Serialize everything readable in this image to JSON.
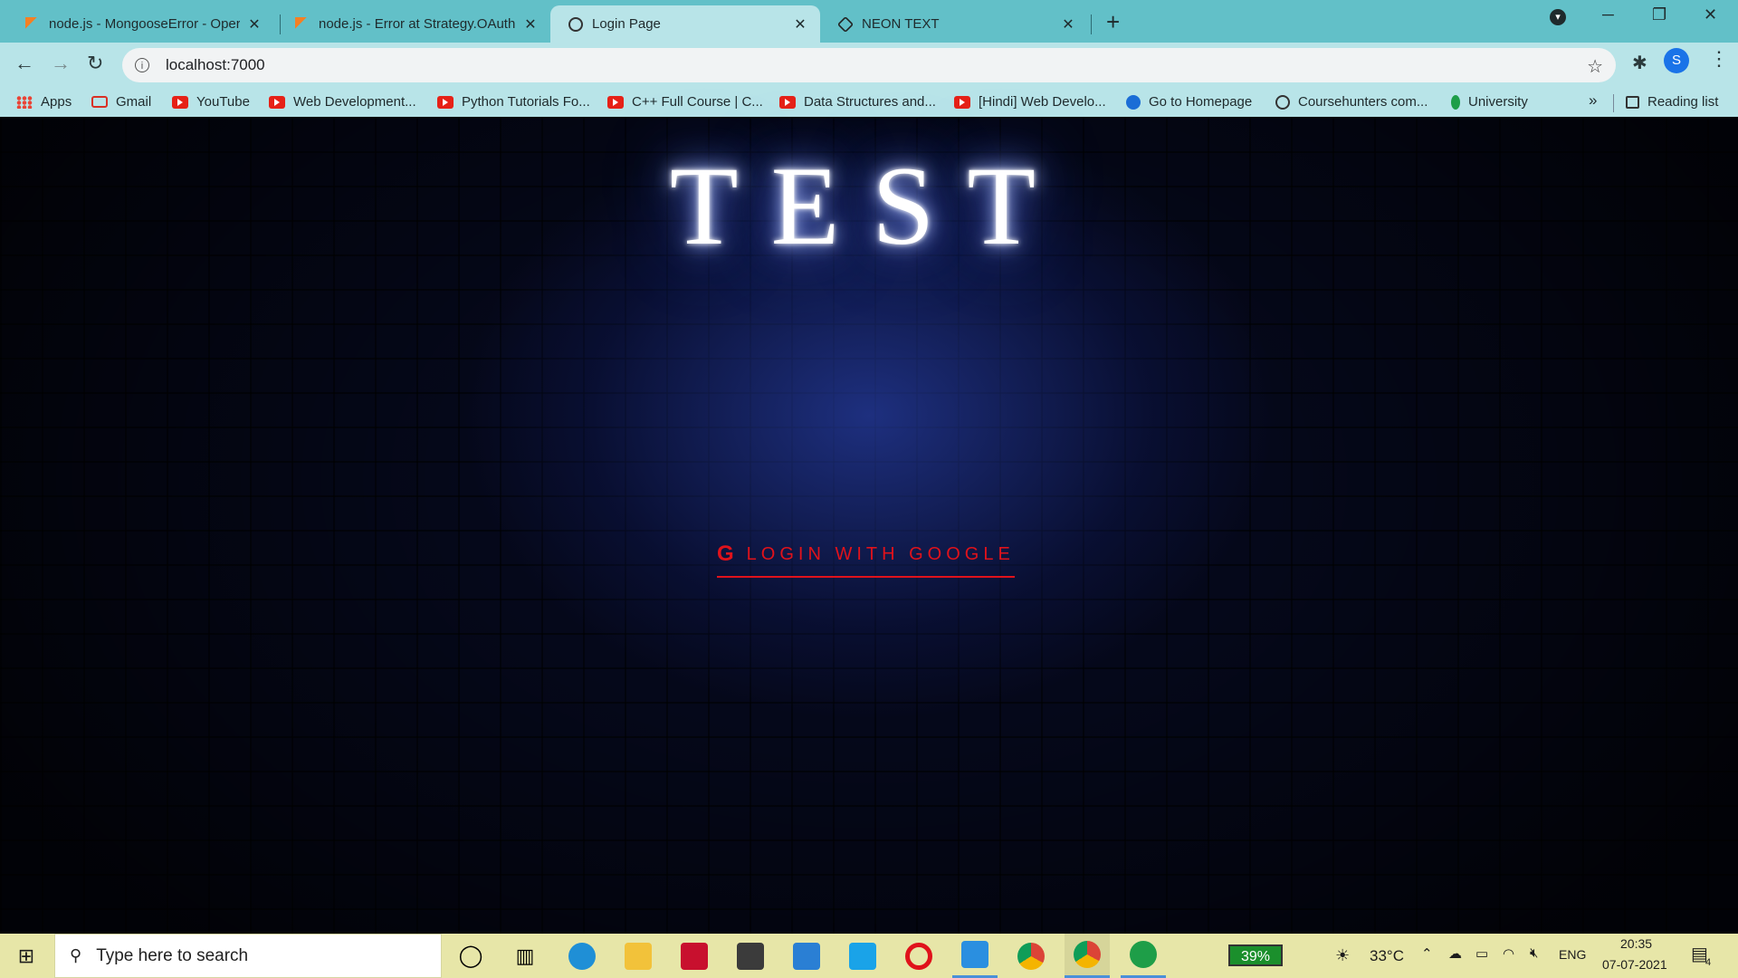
{
  "browser": {
    "tabs": [
      {
        "title": "node.js - MongooseError - Opera",
        "active": false
      },
      {
        "title": "node.js - Error at Strategy.OAuth",
        "active": false
      },
      {
        "title": "Login Page",
        "active": true
      },
      {
        "title": "NEON TEXT",
        "active": false
      }
    ],
    "url": "localhost:7000",
    "profile_initial": "S"
  },
  "bookmarks": [
    {
      "label": "Apps",
      "icon": "apps-icon"
    },
    {
      "label": "Gmail",
      "icon": "gmail-icon"
    },
    {
      "label": "YouTube",
      "icon": "youtube-icon"
    },
    {
      "label": "Web Development...",
      "icon": "youtube-icon"
    },
    {
      "label": "Python Tutorials Fo...",
      "icon": "youtube-icon"
    },
    {
      "label": "C++ Full Course | C...",
      "icon": "youtube-icon"
    },
    {
      "label": "Data Structures and...",
      "icon": "youtube-icon"
    },
    {
      "label": "[Hindi] Web Develo...",
      "icon": "youtube-icon"
    },
    {
      "label": "Go to Homepage",
      "icon": "home-icon"
    },
    {
      "label": "Coursehunters com...",
      "icon": "globe-icon"
    },
    {
      "label": "University",
      "icon": "leaf-icon"
    }
  ],
  "bookmarks_more": "»",
  "reading_list": "Reading list",
  "page": {
    "title": "TEST",
    "login_icon": "G",
    "login_label": "LOGIN WITH GOOGLE"
  },
  "taskbar": {
    "search_placeholder": "Type here to search",
    "battery": "39%",
    "weather": "33°C",
    "language": "ENG",
    "time": "20:35",
    "date": "07-07-2021",
    "notifications": "4"
  },
  "colors": {
    "tab_strip": "#62c0c8",
    "toolbar": "#b8e4e8",
    "login_red": "#e0121b",
    "taskbar": "#e7e6a8"
  }
}
